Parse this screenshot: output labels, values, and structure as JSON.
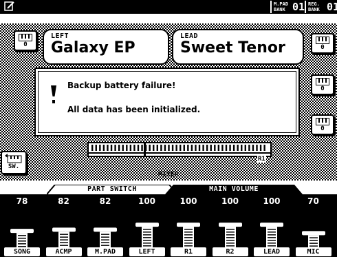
{
  "top_bar": {
    "mpad_bank_label": "M.PAD BANK",
    "mpad_bank_value": "01",
    "reg_bank_label": "REG. BANK",
    "reg_bank_value": "01"
  },
  "voices": {
    "left": {
      "part": "LEFT",
      "name": "Galaxy EP"
    },
    "lead": {
      "part": "LEAD",
      "name": "Sweet Tenor"
    }
  },
  "side_buttons": {
    "left_top": "0",
    "right_top": "0",
    "right_mid": "0",
    "right_low": "0"
  },
  "dialog": {
    "line1": "Backup battery failure!",
    "line2": "All data has been initialized."
  },
  "keyboard": {
    "split_label": "R1"
  },
  "sw_button": {
    "label": "SW."
  },
  "mixer": {
    "title": "MIXER",
    "tabs": [
      "PART SWITCH",
      "MAIN VOLUME"
    ],
    "channels": [
      {
        "label": "SONG",
        "value": "78",
        "level": 0.614
      },
      {
        "label": "ACMP",
        "value": "82",
        "level": 0.646
      },
      {
        "label": "M.PAD",
        "value": "82",
        "level": 0.646
      },
      {
        "label": "LEFT",
        "value": "100",
        "level": 0.787
      },
      {
        "label": "R1",
        "value": "100",
        "level": 0.787
      },
      {
        "label": "R2",
        "value": "100",
        "level": 0.787
      },
      {
        "label": "LEAD",
        "value": "100",
        "level": 0.787
      },
      {
        "label": "MIC",
        "value": "70",
        "level": 0.551
      }
    ]
  }
}
